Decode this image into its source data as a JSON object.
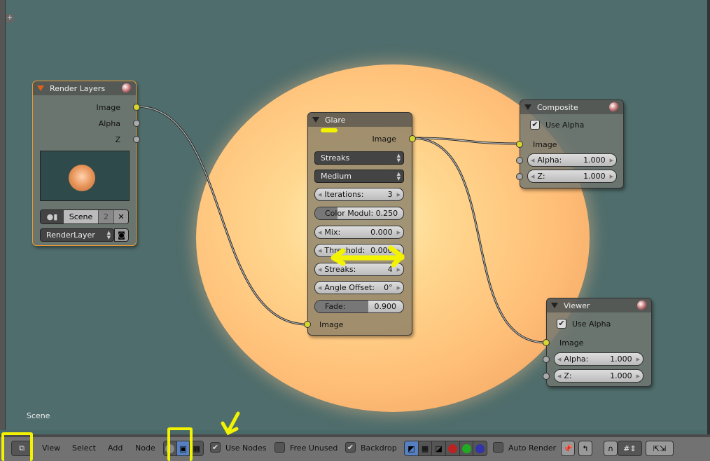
{
  "backdrop_label": "Scene",
  "nodes": {
    "render_layers": {
      "title": "Render Layers",
      "outputs": [
        "Image",
        "Alpha",
        "Z"
      ],
      "scene": "Scene",
      "users": "2",
      "layer": "RenderLayer"
    },
    "glare": {
      "title": "Glare",
      "output": "Image",
      "type": "Streaks",
      "quality": "Medium",
      "iterations_label": "Iterations:",
      "iterations": "3",
      "color_mod": "Color Modul: 0.250",
      "color_mod_value": 0.25,
      "mix_label": "Mix:",
      "mix": "0.000",
      "threshold_label": "Threshold:",
      "threshold": "0.000",
      "streaks_label": "Streaks:",
      "streaks": "4",
      "angle_label": "Angle Offset:",
      "angle": "0°",
      "fade_label": "Fade:",
      "fade": "0.900",
      "fade_value": 0.9,
      "input": "Image"
    },
    "composite": {
      "title": "Composite",
      "use_alpha": "Use Alpha",
      "use_alpha_checked": true,
      "input": "Image",
      "alpha_label": "Alpha:",
      "alpha": "1.000",
      "z_label": "Z:",
      "z": "1.000"
    },
    "viewer": {
      "title": "Viewer",
      "use_alpha": "Use Alpha",
      "use_alpha_checked": true,
      "input": "Image",
      "alpha_label": "Alpha:",
      "alpha": "1.000",
      "z_label": "Z:",
      "z": "1.000"
    }
  },
  "header": {
    "menus": [
      "View",
      "Select",
      "Add",
      "Node"
    ],
    "use_nodes": "Use Nodes",
    "use_nodes_checked": true,
    "free_unused": "Free Unused",
    "free_unused_checked": false,
    "backdrop": "Backdrop",
    "backdrop_checked": true,
    "auto_render": "Auto Render",
    "auto_render_checked": false
  },
  "colors": {
    "socket_image": "#d6d630",
    "socket_value": "#aaaaaa",
    "annotation": "#f3f300",
    "selected_border": "#f09a30"
  }
}
